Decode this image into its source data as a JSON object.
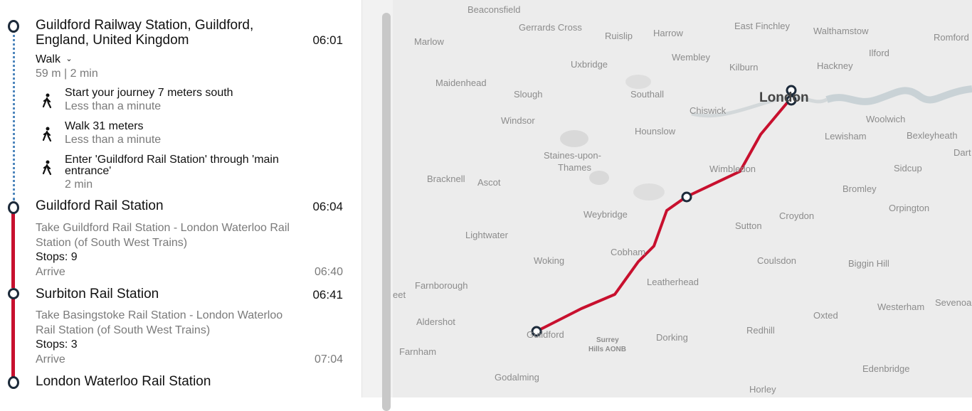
{
  "journey": {
    "origin": {
      "name_line1": "Guildford Railway Station, Guildford,",
      "name_line2": "England, United Kingdom",
      "time": "06:01"
    },
    "walk": {
      "mode_label": "Walk",
      "summary": "59 m | 2 min",
      "steps": [
        {
          "instruction": "Start your journey 7 meters south",
          "duration": "Less than a minute"
        },
        {
          "instruction": "Walk 31 meters",
          "duration": "Less than a minute"
        },
        {
          "instruction_line1": "Enter 'Guildford Rail Station' through 'main",
          "instruction_line2": "entrance'",
          "duration": "2 min"
        }
      ]
    },
    "legs": [
      {
        "station": "Guildford Rail Station",
        "depart_time": "06:04",
        "service_line1": "Take Guildford Rail Station - London Waterloo Rail",
        "service_line2": "Station (of South West Trains)",
        "stops": "Stops: 9",
        "arrive_label": "Arrive",
        "arrive_time": "06:40"
      },
      {
        "station": "Surbiton Rail Station",
        "depart_time": "06:41",
        "service_line1": "Take Basingstoke Rail Station - London Waterloo",
        "service_line2": "Rail Station (of South West Trains)",
        "stops": "Stops: 3",
        "arrive_label": "Arrive",
        "arrive_time": "07:04"
      }
    ],
    "destination": {
      "name": "London Waterloo Rail Station"
    }
  },
  "map": {
    "labels": {
      "beaconsfield": "Beaconsfield",
      "gerrards_cross": "Gerrards Cross",
      "ruislip": "Ruislip",
      "harrow": "Harrow",
      "east_finchley": "East Finchley",
      "walthamstow": "Walthamstow",
      "romford": "Romford",
      "marlow": "Marlow",
      "wembley": "Wembley",
      "ilford": "Ilford",
      "uxbridge": "Uxbridge",
      "kilburn": "Kilburn",
      "hackney": "Hackney",
      "maidenhead": "Maidenhead",
      "slough": "Slough",
      "southall": "Southall",
      "london": "London",
      "chiswick": "Chiswick",
      "windsor": "Windsor",
      "woolwich": "Woolwich",
      "hounslow": "Hounslow",
      "lewisham": "Lewisham",
      "bexleyheath": "Bexleyheath",
      "dart": "Dart",
      "staines_1": "Staines-upon-",
      "staines_2": "Thames",
      "wimbledon": "Wimbledon",
      "bracknell": "Bracknell",
      "ascot": "Ascot",
      "sidcup": "Sidcup",
      "bromley": "Bromley",
      "orpington": "Orpington",
      "weybridge": "Weybridge",
      "croydon": "Croydon",
      "lightwater": "Lightwater",
      "sutton": "Sutton",
      "cobham": "Cobham",
      "woking": "Woking",
      "coulsdon": "Coulsdon",
      "biggin_hill": "Biggin Hill",
      "leatherhead": "Leatherhead",
      "farnborough": "Farnborough",
      "eet": "eet",
      "westerham": "Westerham",
      "sevenoaks": "Sevenoa",
      "oxted": "Oxted",
      "aldershot": "Aldershot",
      "redhill": "Redhill",
      "guildford": "Guildford",
      "surrey_1": "Surrey",
      "surrey_2": "Hills AONB",
      "dorking": "Dorking",
      "farnham": "Farnham",
      "edenbridge": "Edenbridge",
      "godalming": "Godalming",
      "horley": "Horley"
    },
    "route_color": "#c8102e",
    "marker_color": "#1c2a3a",
    "walk_line_color": "#4f87bd"
  }
}
